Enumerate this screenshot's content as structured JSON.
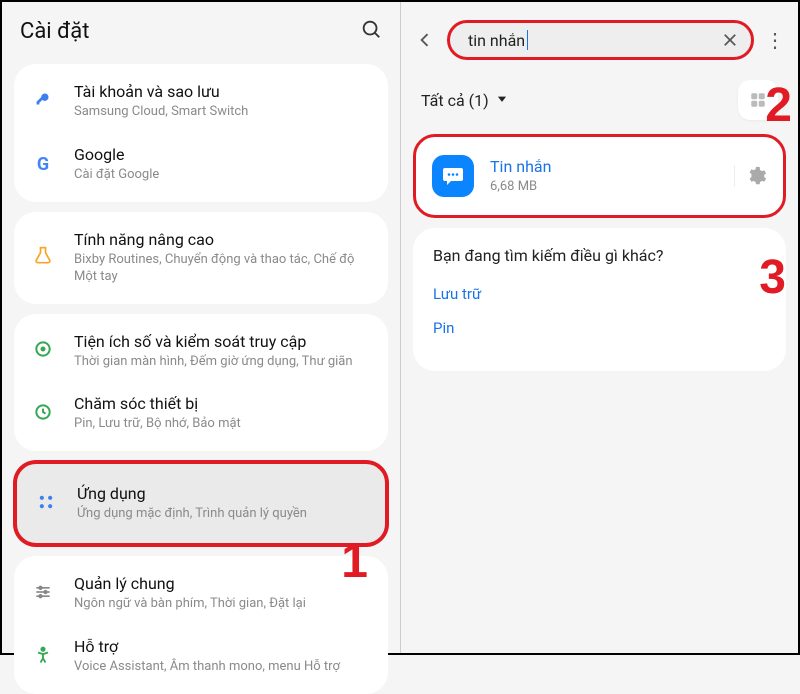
{
  "left": {
    "header_title": "Cài đặt",
    "groups": [
      {
        "items": [
          {
            "icon": "key-icon",
            "title": "Tài khoản và sao lưu",
            "sub": "Samsung Cloud, Smart Switch",
            "color": "#3d7ef0"
          },
          {
            "icon": "google-icon",
            "title": "Google",
            "sub": "Cài đặt Google",
            "color": ""
          }
        ]
      },
      {
        "items": [
          {
            "icon": "lab-icon",
            "title": "Tính năng nâng cao",
            "sub": "Bixby Routines, Chuyển động và thao tác, Chế độ Một tay",
            "color": "#f5a623"
          }
        ]
      },
      {
        "items": [
          {
            "icon": "wellbeing-icon",
            "title": "Tiện ích số và kiểm soát truy cập",
            "sub": "Thời gian màn hình, Đếm giờ ứng dụng, Thư giãn",
            "color": "#34a853"
          },
          {
            "icon": "device-care-icon",
            "title": "Chăm sóc thiết bị",
            "sub": "Pin, Lưu trữ, Bộ nhớ, Bảo mật",
            "color": "#34a853"
          }
        ]
      },
      {
        "apps": true,
        "items": [
          {
            "icon": "apps-icon",
            "title": "Ứng dụng",
            "sub": "Ứng dụng mặc định, Trình quản lý quyền",
            "color": "#3d7ef0"
          }
        ]
      },
      {
        "items": [
          {
            "icon": "general-icon",
            "title": "Quản lý chung",
            "sub": "Ngôn ngữ và bàn phím, Thời gian, Đặt lại",
            "color": "#888"
          },
          {
            "icon": "accessibility-icon",
            "title": "Hỗ trợ",
            "sub": "Voice Assistant, Âm thanh mono, menu Hỗ trợ",
            "color": "#34a853"
          }
        ]
      }
    ]
  },
  "right": {
    "search_value": "tin nhắn",
    "filter_label": "Tất cả (1)",
    "result": {
      "title": "Tin nhắn",
      "size": "6,68 MB"
    },
    "other_heading": "Bạn đang tìm kiếm điều gì khác?",
    "other_links": [
      "Lưu trữ",
      "Pin"
    ]
  },
  "annotations": {
    "a1": "1",
    "a2": "2",
    "a3": "3"
  }
}
